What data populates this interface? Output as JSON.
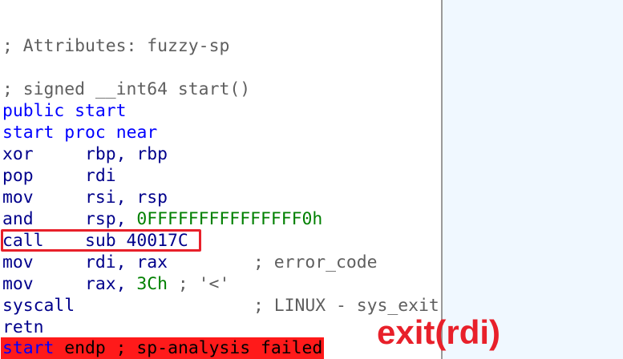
{
  "code": {
    "attributes_comment": "; Attributes: fuzzy-sp",
    "signature_comment": "; signed __int64 start()",
    "public_kw": "public",
    "public_name": "start",
    "proc_name": "start",
    "proc_kw": "proc near",
    "instr": [
      {
        "m": "xor",
        "ops": "rbp, rbp"
      },
      {
        "m": "pop",
        "ops": "rdi"
      },
      {
        "m": "mov",
        "ops": "rsi, rsp"
      },
      {
        "m": "and",
        "ops_prefix": "rsp, ",
        "ops_num": "0FFFFFFFFFFFFFFF0h"
      },
      {
        "m": "call",
        "ops": "sub_40017C"
      },
      {
        "m": "mov",
        "ops": "rdi, rax",
        "comment": "; error_code"
      },
      {
        "m": "mov",
        "ops_prefix": "rax, ",
        "ops_num": "3Ch",
        "comment": " ; '<'"
      },
      {
        "m": "syscall",
        "comment": "; LINUX - sys_exit"
      },
      {
        "m": "retn"
      }
    ],
    "endp_name": "start",
    "endp_rest": " endp ; sp-analysis failed"
  },
  "annotation": {
    "text": "exit(rdi)",
    "color": "#e8202a"
  },
  "colors": {
    "keyword": "#0000ff",
    "number": "#008000",
    "highlight": "#ff1a1a"
  }
}
